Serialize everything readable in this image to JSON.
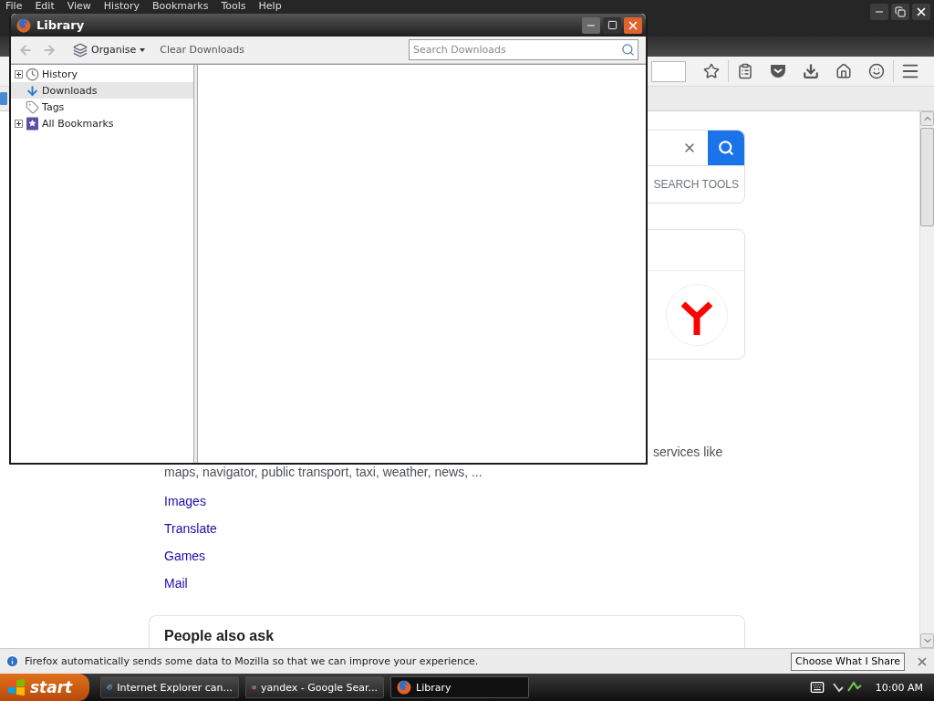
{
  "browser": {
    "menu": [
      "File",
      "Edit",
      "View",
      "History",
      "Bookmarks",
      "Tools",
      "Help"
    ],
    "page": {
      "search_tools": "SEARCH TOOLS",
      "description_line_1": "services like",
      "description_line_2": "maps, navigator, public transport, taxi, weather, news, ...",
      "links": [
        "Images",
        "Translate",
        "Games",
        "Mail"
      ],
      "people_also_ask": "People also ask"
    },
    "notification": {
      "text": "Firefox automatically sends some data to Mozilla so that we can improve your experience.",
      "button": "Choose What I Share"
    }
  },
  "library": {
    "title": "Library",
    "back": {
      "disabled": true
    },
    "forward": {
      "disabled": true
    },
    "organise": "Organise",
    "clear": "Clear Downloads",
    "search": {
      "placeholder": "Search Downloads"
    },
    "tree": [
      {
        "label": "History",
        "kind": "history",
        "selected": false
      },
      {
        "label": "Downloads",
        "kind": "downloads",
        "selected": true
      },
      {
        "label": "Tags",
        "kind": "tags",
        "selected": false
      },
      {
        "label": "All Bookmarks",
        "kind": "bookmarks",
        "selected": false
      }
    ]
  },
  "taskbar": {
    "start": "start",
    "tasks": [
      {
        "label": "Internet Explorer can...",
        "kind": "ie",
        "selected": false
      },
      {
        "label": "yandex - Google Sear...",
        "kind": "firefox",
        "selected": false
      },
      {
        "label": "Library",
        "kind": "firefox",
        "selected": true
      }
    ],
    "clock": "10:00 AM"
  }
}
